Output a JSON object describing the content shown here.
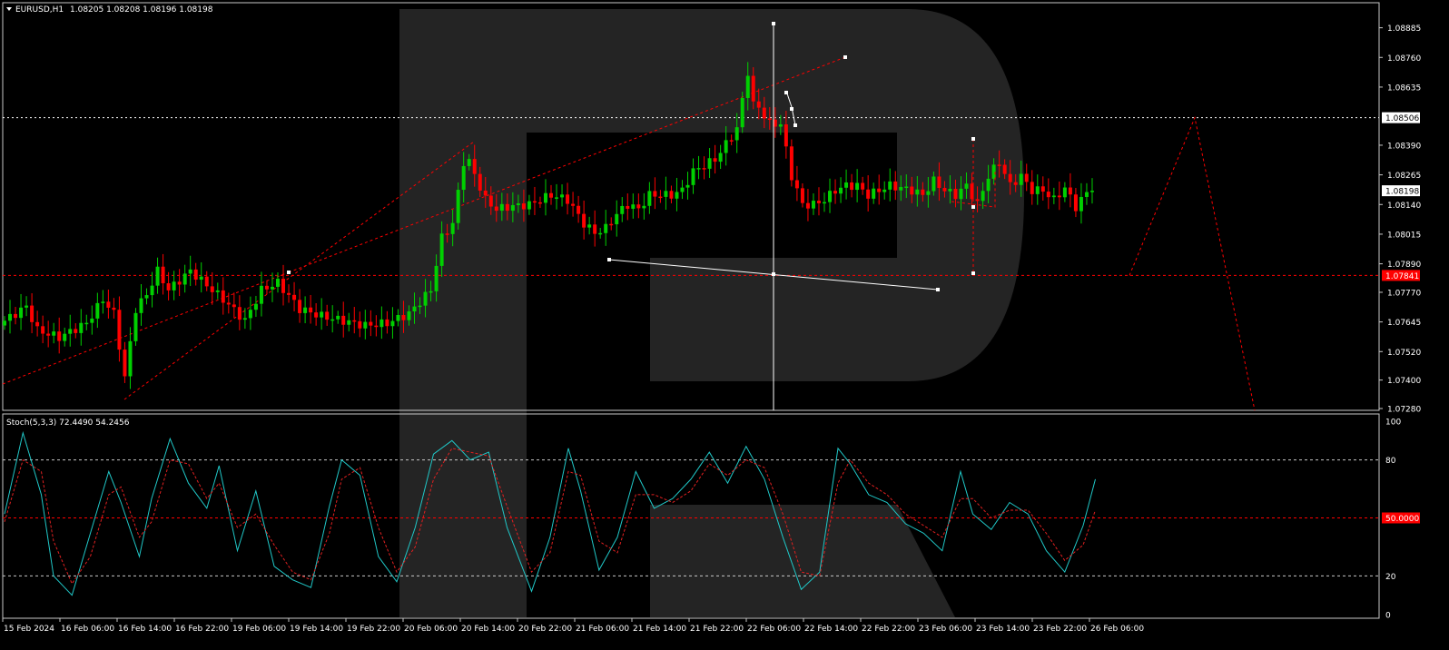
{
  "header": {
    "symbol_label": "EURUSD,H1",
    "ohlc_label": "1.08205 1.08208 1.08196 1.08198",
    "indicator_label": "Stoch(5,3,3) 72.4490 54.2456"
  },
  "colors": {
    "background": "#000000",
    "bull": "#00d000",
    "bear": "#ff0000",
    "stoch_main": "#20c8c8",
    "stoch_signal": "#e02020",
    "watermark": "#242424",
    "level_line": "#ffffff",
    "support_line": "#ff0000"
  },
  "chart_data": [
    {
      "type": "candlestick",
      "symbol": "EURUSD",
      "timeframe": "H1",
      "price_ticks": [
        "1.08885",
        "1.08760",
        "1.08635",
        "1.08506",
        "1.08390",
        "1.08265",
        "1.08198",
        "1.08140",
        "1.08015",
        "1.07890",
        "1.07841",
        "1.07770",
        "1.07645",
        "1.07520",
        "1.07400",
        "1.07280"
      ],
      "price_range": [
        1.0728,
        1.0896
      ],
      "time_labels": [
        "15 Feb 2024",
        "16 Feb 06:00",
        "16 Feb 14:00",
        "16 Feb 22:00",
        "19 Feb 06:00",
        "19 Feb 14:00",
        "19 Feb 22:00",
        "20 Feb 06:00",
        "20 Feb 14:00",
        "20 Feb 22:00",
        "21 Feb 06:00",
        "21 Feb 14:00",
        "21 Feb 22:00",
        "22 Feb 06:00",
        "22 Feb 14:00",
        "22 Feb 22:00",
        "23 Feb 06:00",
        "23 Feb 14:00",
        "23 Feb 22:00",
        "26 Feb 06:00"
      ],
      "current_price": "1.08198",
      "resistance_level": "1.08506",
      "support_level": "1.07841",
      "close_anchors": [
        [
          0,
          1.0765
        ],
        [
          4,
          1.0771
        ],
        [
          6,
          1.0761
        ],
        [
          10,
          1.0758
        ],
        [
          15,
          1.0764
        ],
        [
          18,
          1.0774
        ],
        [
          20,
          1.0768
        ],
        [
          22,
          1.0741
        ],
        [
          24,
          1.077
        ],
        [
          26,
          1.0776
        ],
        [
          28,
          1.0786
        ],
        [
          30,
          1.0778
        ],
        [
          34,
          1.0786
        ],
        [
          36,
          1.0782
        ],
        [
          40,
          1.0774
        ],
        [
          44,
          1.0765
        ],
        [
          47,
          1.0778
        ],
        [
          50,
          1.0781
        ],
        [
          54,
          1.077
        ],
        [
          58,
          1.0767
        ],
        [
          62,
          1.0765
        ],
        [
          66,
          1.0763
        ],
        [
          70,
          1.0764
        ],
        [
          74,
          1.0768
        ],
        [
          78,
          1.0778
        ],
        [
          80,
          1.08
        ],
        [
          82,
          1.0806
        ],
        [
          84,
          1.0832
        ],
        [
          85,
          1.0832
        ],
        [
          88,
          1.0816
        ],
        [
          90,
          1.0812
        ],
        [
          92,
          1.0813
        ],
        [
          96,
          1.0814
        ],
        [
          100,
          1.0818
        ],
        [
          103,
          1.0816
        ],
        [
          106,
          1.0806
        ],
        [
          108,
          1.0802
        ],
        [
          110,
          1.0804
        ],
        [
          112,
          1.081
        ],
        [
          114,
          1.0814
        ],
        [
          116,
          1.0812
        ],
        [
          118,
          1.0818
        ],
        [
          120,
          1.0818
        ],
        [
          122,
          1.0818
        ],
        [
          124,
          1.082
        ],
        [
          126,
          1.0828
        ],
        [
          130,
          1.0833
        ],
        [
          134,
          1.0846
        ],
        [
          136,
          1.087
        ],
        [
          137,
          1.0856
        ],
        [
          138,
          1.0855
        ],
        [
          140,
          1.0848
        ],
        [
          142,
          1.0848
        ],
        [
          144,
          1.0826
        ],
        [
          146,
          1.0814
        ],
        [
          148,
          1.0814
        ],
        [
          150,
          1.0816
        ],
        [
          152,
          1.082
        ],
        [
          154,
          1.0822
        ],
        [
          156,
          1.0822
        ],
        [
          158,
          1.0818
        ],
        [
          162,
          1.0822
        ],
        [
          166,
          1.082
        ],
        [
          168,
          1.0818
        ],
        [
          170,
          1.0824
        ],
        [
          172,
          1.082
        ],
        [
          174,
          1.0818
        ],
        [
          176,
          1.0822
        ],
        [
          178,
          1.0814
        ],
        [
          180,
          1.0826
        ],
        [
          182,
          1.0832
        ],
        [
          184,
          1.0822
        ],
        [
          186,
          1.0826
        ],
        [
          188,
          1.082
        ],
        [
          190,
          1.082
        ],
        [
          192,
          1.0816
        ],
        [
          194,
          1.0821
        ],
        [
          196,
          1.0813
        ],
        [
          198,
          1.0819
        ],
        [
          199,
          1.08198
        ]
      ],
      "forecast_path": [
        [
          1.07841
        ],
        [
          1.08506
        ],
        [
          1.0728
        ]
      ]
    },
    {
      "type": "line",
      "title": "Stoch(5,3,3)",
      "y_ticks": [
        "100",
        "80",
        "50.0000",
        "20",
        "0"
      ],
      "ylim": [
        0,
        100
      ],
      "levels": [
        80,
        50,
        20
      ],
      "series": [
        {
          "name": "main",
          "points": [
            [
              0,
              52
            ],
            [
              3,
              94
            ],
            [
              6,
              62
            ],
            [
              8,
              20
            ],
            [
              11,
              10
            ],
            [
              14,
              42
            ],
            [
              17,
              74
            ],
            [
              19,
              58
            ],
            [
              22,
              30
            ],
            [
              24,
              60
            ],
            [
              27,
              91
            ],
            [
              30,
              68
            ],
            [
              33,
              55
            ],
            [
              35,
              77
            ],
            [
              38,
              33
            ],
            [
              41,
              64
            ],
            [
              44,
              25
            ],
            [
              47,
              18
            ],
            [
              50,
              14
            ],
            [
              53,
              56
            ],
            [
              55,
              80
            ],
            [
              58,
              72
            ],
            [
              61,
              30
            ],
            [
              64,
              17
            ],
            [
              67,
              45
            ],
            [
              70,
              83
            ],
            [
              73,
              90
            ],
            [
              76,
              80
            ],
            [
              79,
              84
            ],
            [
              82,
              45
            ],
            [
              86,
              12
            ],
            [
              89,
              40
            ],
            [
              92,
              86
            ],
            [
              94,
              64
            ],
            [
              97,
              23
            ],
            [
              100,
              40
            ],
            [
              103,
              74
            ],
            [
              106,
              55
            ],
            [
              109,
              60
            ],
            [
              112,
              70
            ],
            [
              115,
              84
            ],
            [
              118,
              68
            ],
            [
              121,
              87
            ],
            [
              124,
              70
            ],
            [
              127,
              40
            ],
            [
              130,
              13
            ],
            [
              133,
              22
            ],
            [
              136,
              86
            ],
            [
              138,
              78
            ],
            [
              141,
              62
            ],
            [
              144,
              58
            ],
            [
              147,
              47
            ],
            [
              150,
              42
            ],
            [
              153,
              33
            ],
            [
              156,
              74
            ],
            [
              158,
              52
            ],
            [
              161,
              44
            ],
            [
              164,
              58
            ],
            [
              167,
              52
            ],
            [
              170,
              33
            ],
            [
              173,
              22
            ],
            [
              176,
              46
            ],
            [
              178,
              70
            ]
          ]
        },
        {
          "name": "signal",
          "points": [
            [
              0,
              48
            ],
            [
              3,
              80
            ],
            [
              6,
              74
            ],
            [
              8,
              38
            ],
            [
              11,
              16
            ],
            [
              14,
              30
            ],
            [
              17,
              62
            ],
            [
              19,
              66
            ],
            [
              22,
              40
            ],
            [
              24,
              48
            ],
            [
              27,
              80
            ],
            [
              30,
              78
            ],
            [
              33,
              60
            ],
            [
              35,
              68
            ],
            [
              38,
              45
            ],
            [
              41,
              52
            ],
            [
              44,
              36
            ],
            [
              47,
              22
            ],
            [
              50,
              18
            ],
            [
              53,
              42
            ],
            [
              55,
              70
            ],
            [
              58,
              76
            ],
            [
              61,
              45
            ],
            [
              64,
              22
            ],
            [
              67,
              35
            ],
            [
              70,
              70
            ],
            [
              73,
              86
            ],
            [
              76,
              84
            ],
            [
              79,
              82
            ],
            [
              82,
              56
            ],
            [
              86,
              22
            ],
            [
              89,
              32
            ],
            [
              92,
              74
            ],
            [
              94,
              72
            ],
            [
              97,
              38
            ],
            [
              100,
              32
            ],
            [
              103,
              62
            ],
            [
              106,
              62
            ],
            [
              109,
              58
            ],
            [
              112,
              64
            ],
            [
              115,
              78
            ],
            [
              118,
              72
            ],
            [
              121,
              80
            ],
            [
              124,
              76
            ],
            [
              127,
              52
            ],
            [
              130,
              22
            ],
            [
              133,
              20
            ],
            [
              136,
              68
            ],
            [
              138,
              80
            ],
            [
              141,
              68
            ],
            [
              144,
              62
            ],
            [
              147,
              52
            ],
            [
              150,
              46
            ],
            [
              153,
              40
            ],
            [
              156,
              60
            ],
            [
              158,
              60
            ],
            [
              161,
              50
            ],
            [
              164,
              54
            ],
            [
              167,
              54
            ],
            [
              170,
              42
            ],
            [
              173,
              28
            ],
            [
              176,
              36
            ],
            [
              178,
              54
            ]
          ]
        }
      ]
    }
  ]
}
